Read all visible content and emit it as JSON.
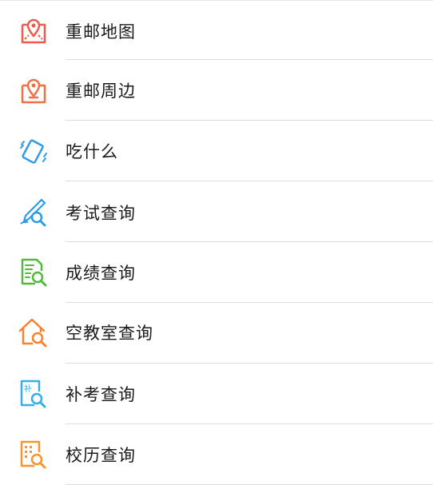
{
  "menu": {
    "items": [
      {
        "label": "重邮地图",
        "icon": "map-pin-icon",
        "color": "#ee5a4c"
      },
      {
        "label": "重邮周边",
        "icon": "nearby-pin-icon",
        "color": "#f36f45"
      },
      {
        "label": "吃什么",
        "icon": "shake-phone-icon",
        "color": "#2e9be8"
      },
      {
        "label": "考试查询",
        "icon": "pen-search-icon",
        "color": "#2e9be8"
      },
      {
        "label": "成绩查询",
        "icon": "score-search-icon",
        "color": "#53b93b"
      },
      {
        "label": "空教室查询",
        "icon": "room-search-icon",
        "color": "#f7812f"
      },
      {
        "label": "补考查询",
        "icon": "makeup-search-icon",
        "color": "#36aee8"
      },
      {
        "label": "校历查询",
        "icon": "calendar-search-icon",
        "color": "#f7942f"
      }
    ]
  }
}
